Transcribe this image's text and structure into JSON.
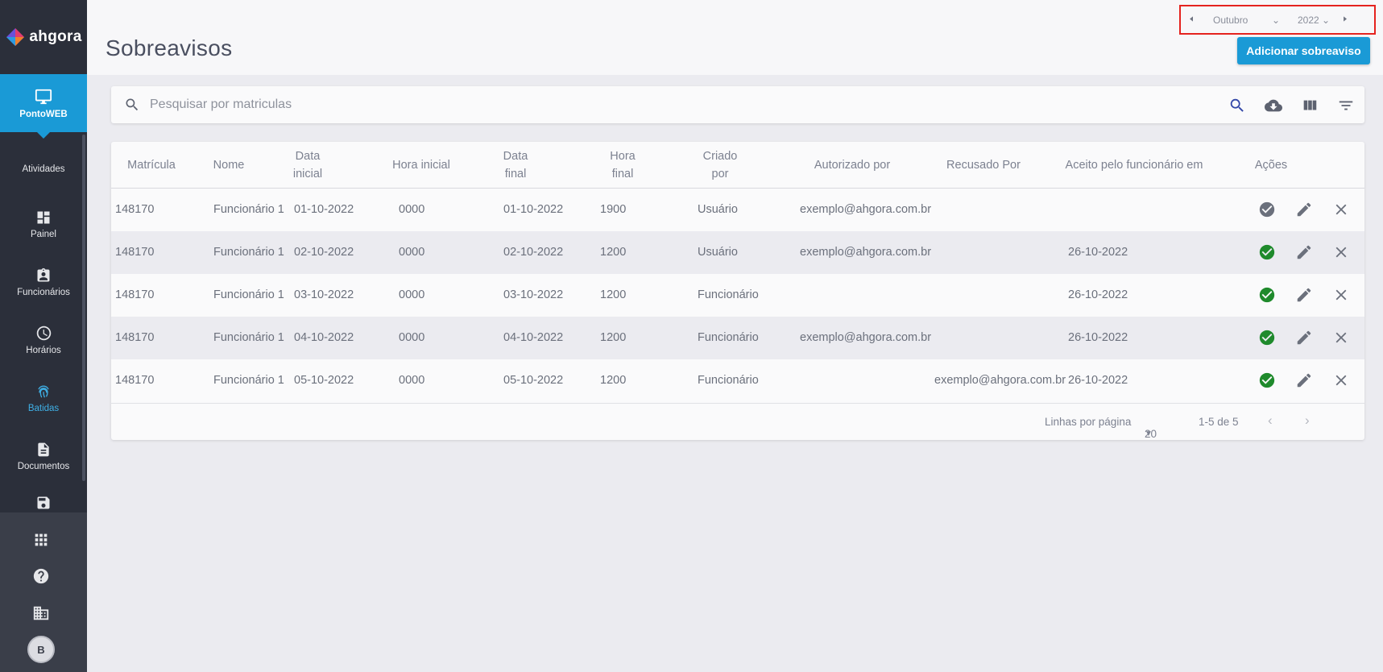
{
  "brand": {
    "name": "ahgora"
  },
  "sidebar": {
    "items": [
      {
        "label": "PontoWEB",
        "icon": "monitor-icon",
        "active": true
      },
      {
        "label": "Atividades"
      },
      {
        "label": "Painel",
        "icon": "dashboard-icon"
      },
      {
        "label": "Funcionários",
        "icon": "badge-icon"
      },
      {
        "label": "Horários",
        "icon": "clock-icon"
      },
      {
        "label": "Batidas",
        "icon": "fingerprint-icon"
      },
      {
        "label": "Documentos",
        "icon": "document-icon"
      }
    ],
    "avatar_initial": "B"
  },
  "header": {
    "title": "Sobreavisos",
    "add_button": "Adicionar sobreaviso",
    "period": {
      "month": "Outubro",
      "year": "2022"
    }
  },
  "search": {
    "placeholder": "Pesquisar por matriculas"
  },
  "table": {
    "columns": [
      "Matrícula",
      "Nome",
      "Data inicial",
      "Hora inicial",
      "Data final",
      "Hora final",
      "Criado por",
      "Autorizado por",
      "Recusado Por",
      "Aceito pelo funcionário em",
      "Ações"
    ],
    "rows": [
      {
        "matricula": "148170",
        "nome": "Funcionário 1",
        "data_inicial": "01-10-2022",
        "hora_inicial": "0000",
        "data_final": "01-10-2022",
        "hora_final": "1900",
        "criado_por": "Usuário",
        "autorizado_por": "exemplo@ahgora.com.br",
        "recusado_por": "",
        "aceito_em": "",
        "status": "pending"
      },
      {
        "matricula": "148170",
        "nome": "Funcionário 1",
        "data_inicial": "02-10-2022",
        "hora_inicial": "0000",
        "data_final": "02-10-2022",
        "hora_final": "1200",
        "criado_por": "Usuário",
        "autorizado_por": "exemplo@ahgora.com.br",
        "recusado_por": "",
        "aceito_em": "26-10-2022",
        "status": "accepted"
      },
      {
        "matricula": "148170",
        "nome": "Funcionário 1",
        "data_inicial": "03-10-2022",
        "hora_inicial": "0000",
        "data_final": "03-10-2022",
        "hora_final": "1200",
        "criado_por": "Funcionário",
        "autorizado_por": "",
        "recusado_por": "",
        "aceito_em": "26-10-2022",
        "status": "accepted"
      },
      {
        "matricula": "148170",
        "nome": "Funcionário 1",
        "data_inicial": "04-10-2022",
        "hora_inicial": "0000",
        "data_final": "04-10-2022",
        "hora_final": "1200",
        "criado_por": "Funcionário",
        "autorizado_por": "exemplo@ahgora.com.br",
        "recusado_por": "",
        "aceito_em": "26-10-2022",
        "status": "accepted"
      },
      {
        "matricula": "148170",
        "nome": "Funcionário 1",
        "data_inicial": "05-10-2022",
        "hora_inicial": "0000",
        "data_final": "05-10-2022",
        "hora_final": "1200",
        "criado_por": "Funcionário",
        "autorizado_por": "",
        "recusado_por": "exemplo@ahgora.com.br",
        "aceito_em": "26-10-2022",
        "status": "accepted"
      }
    ]
  },
  "pagination": {
    "rows_per_page_label": "Linhas por página",
    "rows_per_page": "20",
    "range": "1-5 de 5"
  },
  "colors": {
    "accent": "#1a9ad6",
    "sidebar": "#2b2f3a",
    "accepted": "#1f8a2c",
    "pending": "#6b707c",
    "highlight_border": "#e5231f"
  }
}
